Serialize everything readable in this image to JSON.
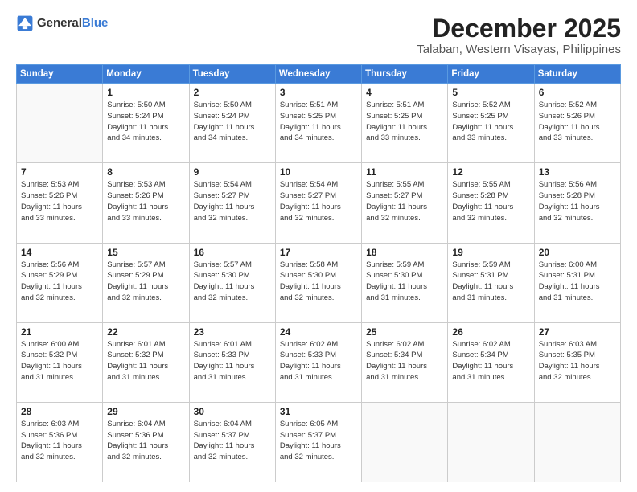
{
  "header": {
    "logo_general": "General",
    "logo_blue": "Blue",
    "month_title": "December 2025",
    "location": "Talaban, Western Visayas, Philippines"
  },
  "days_of_week": [
    "Sunday",
    "Monday",
    "Tuesday",
    "Wednesday",
    "Thursday",
    "Friday",
    "Saturday"
  ],
  "weeks": [
    [
      {
        "day": "",
        "info": ""
      },
      {
        "day": "1",
        "info": "Sunrise: 5:50 AM\nSunset: 5:24 PM\nDaylight: 11 hours\nand 34 minutes."
      },
      {
        "day": "2",
        "info": "Sunrise: 5:50 AM\nSunset: 5:24 PM\nDaylight: 11 hours\nand 34 minutes."
      },
      {
        "day": "3",
        "info": "Sunrise: 5:51 AM\nSunset: 5:25 PM\nDaylight: 11 hours\nand 34 minutes."
      },
      {
        "day": "4",
        "info": "Sunrise: 5:51 AM\nSunset: 5:25 PM\nDaylight: 11 hours\nand 33 minutes."
      },
      {
        "day": "5",
        "info": "Sunrise: 5:52 AM\nSunset: 5:25 PM\nDaylight: 11 hours\nand 33 minutes."
      },
      {
        "day": "6",
        "info": "Sunrise: 5:52 AM\nSunset: 5:26 PM\nDaylight: 11 hours\nand 33 minutes."
      }
    ],
    [
      {
        "day": "7",
        "info": "Sunrise: 5:53 AM\nSunset: 5:26 PM\nDaylight: 11 hours\nand 33 minutes."
      },
      {
        "day": "8",
        "info": "Sunrise: 5:53 AM\nSunset: 5:26 PM\nDaylight: 11 hours\nand 33 minutes."
      },
      {
        "day": "9",
        "info": "Sunrise: 5:54 AM\nSunset: 5:27 PM\nDaylight: 11 hours\nand 32 minutes."
      },
      {
        "day": "10",
        "info": "Sunrise: 5:54 AM\nSunset: 5:27 PM\nDaylight: 11 hours\nand 32 minutes."
      },
      {
        "day": "11",
        "info": "Sunrise: 5:55 AM\nSunset: 5:27 PM\nDaylight: 11 hours\nand 32 minutes."
      },
      {
        "day": "12",
        "info": "Sunrise: 5:55 AM\nSunset: 5:28 PM\nDaylight: 11 hours\nand 32 minutes."
      },
      {
        "day": "13",
        "info": "Sunrise: 5:56 AM\nSunset: 5:28 PM\nDaylight: 11 hours\nand 32 minutes."
      }
    ],
    [
      {
        "day": "14",
        "info": "Sunrise: 5:56 AM\nSunset: 5:29 PM\nDaylight: 11 hours\nand 32 minutes."
      },
      {
        "day": "15",
        "info": "Sunrise: 5:57 AM\nSunset: 5:29 PM\nDaylight: 11 hours\nand 32 minutes."
      },
      {
        "day": "16",
        "info": "Sunrise: 5:57 AM\nSunset: 5:30 PM\nDaylight: 11 hours\nand 32 minutes."
      },
      {
        "day": "17",
        "info": "Sunrise: 5:58 AM\nSunset: 5:30 PM\nDaylight: 11 hours\nand 32 minutes."
      },
      {
        "day": "18",
        "info": "Sunrise: 5:59 AM\nSunset: 5:30 PM\nDaylight: 11 hours\nand 31 minutes."
      },
      {
        "day": "19",
        "info": "Sunrise: 5:59 AM\nSunset: 5:31 PM\nDaylight: 11 hours\nand 31 minutes."
      },
      {
        "day": "20",
        "info": "Sunrise: 6:00 AM\nSunset: 5:31 PM\nDaylight: 11 hours\nand 31 minutes."
      }
    ],
    [
      {
        "day": "21",
        "info": "Sunrise: 6:00 AM\nSunset: 5:32 PM\nDaylight: 11 hours\nand 31 minutes."
      },
      {
        "day": "22",
        "info": "Sunrise: 6:01 AM\nSunset: 5:32 PM\nDaylight: 11 hours\nand 31 minutes."
      },
      {
        "day": "23",
        "info": "Sunrise: 6:01 AM\nSunset: 5:33 PM\nDaylight: 11 hours\nand 31 minutes."
      },
      {
        "day": "24",
        "info": "Sunrise: 6:02 AM\nSunset: 5:33 PM\nDaylight: 11 hours\nand 31 minutes."
      },
      {
        "day": "25",
        "info": "Sunrise: 6:02 AM\nSunset: 5:34 PM\nDaylight: 11 hours\nand 31 minutes."
      },
      {
        "day": "26",
        "info": "Sunrise: 6:02 AM\nSunset: 5:34 PM\nDaylight: 11 hours\nand 31 minutes."
      },
      {
        "day": "27",
        "info": "Sunrise: 6:03 AM\nSunset: 5:35 PM\nDaylight: 11 hours\nand 32 minutes."
      }
    ],
    [
      {
        "day": "28",
        "info": "Sunrise: 6:03 AM\nSunset: 5:36 PM\nDaylight: 11 hours\nand 32 minutes."
      },
      {
        "day": "29",
        "info": "Sunrise: 6:04 AM\nSunset: 5:36 PM\nDaylight: 11 hours\nand 32 minutes."
      },
      {
        "day": "30",
        "info": "Sunrise: 6:04 AM\nSunset: 5:37 PM\nDaylight: 11 hours\nand 32 minutes."
      },
      {
        "day": "31",
        "info": "Sunrise: 6:05 AM\nSunset: 5:37 PM\nDaylight: 11 hours\nand 32 minutes."
      },
      {
        "day": "",
        "info": ""
      },
      {
        "day": "",
        "info": ""
      },
      {
        "day": "",
        "info": ""
      }
    ]
  ]
}
